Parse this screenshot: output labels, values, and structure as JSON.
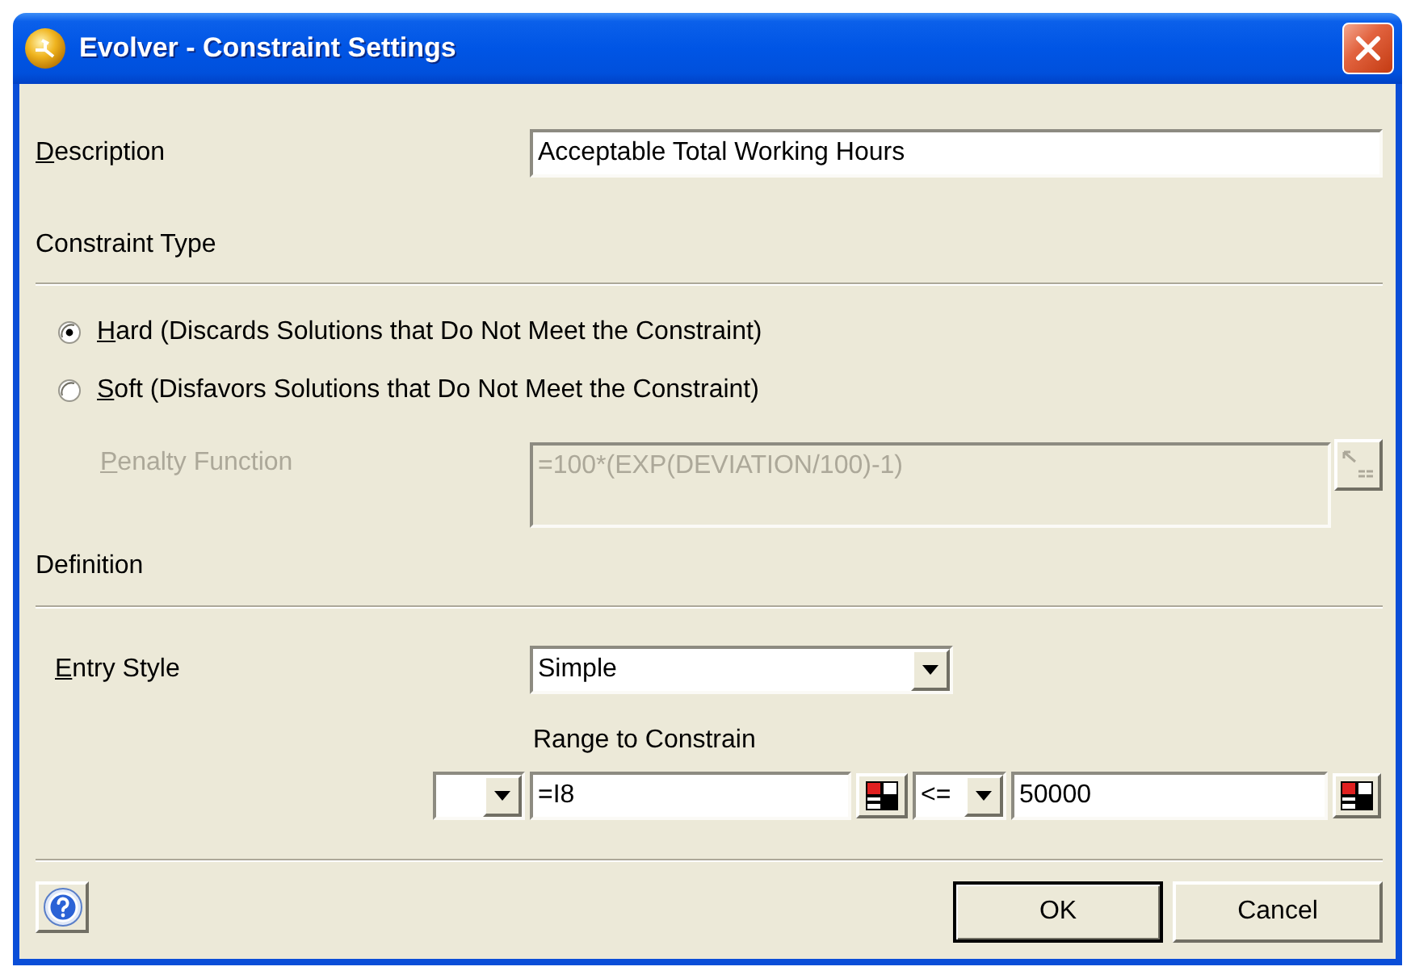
{
  "window": {
    "title": "Evolver - Constraint Settings"
  },
  "description": {
    "label": "Description",
    "access_key_shown": true,
    "value": "Acceptable Total Working Hours"
  },
  "constraint_type": {
    "heading": "Constraint Type",
    "options": [
      {
        "label": "Hard (Discards Solutions that Do Not Meet the Constraint)",
        "access_key_shown": true,
        "selected": true
      },
      {
        "label": "Soft (Disfavors Solutions that Do Not Meet the Constraint)",
        "access_key_shown": true,
        "selected": false
      }
    ],
    "penalty_function": {
      "label": "Penalty Function",
      "access_key_shown": true,
      "value": "=100*(EXP(DEVIATION/100)-1)",
      "disabled": true
    }
  },
  "definition": {
    "heading": "Definition",
    "entry_style": {
      "label": "Entry Style",
      "access_key_shown": true,
      "value": "Simple"
    },
    "range": {
      "label": "Range to Constrain",
      "left_value": "=I8",
      "operator": "<=",
      "right_value": "50000"
    }
  },
  "buttons": [
    {
      "label": "OK",
      "default": true
    },
    {
      "label": "Cancel",
      "default": false
    }
  ]
}
